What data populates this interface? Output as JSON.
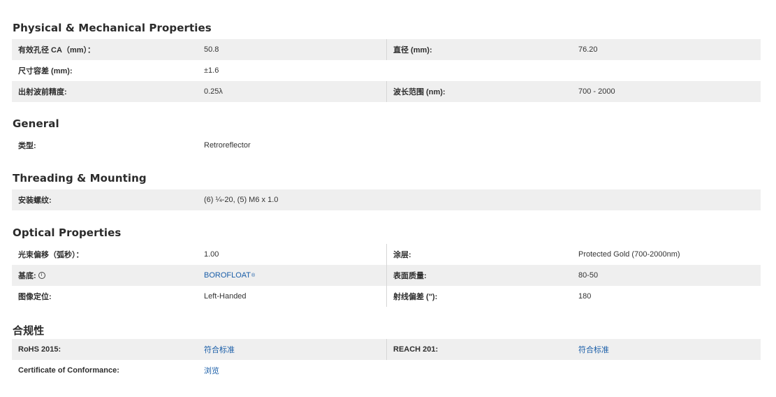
{
  "sections": {
    "physical": {
      "title": "Physical & Mechanical Properties",
      "rows": [
        {
          "l1": "有效孔径 CA（mm）：",
          "v1": "50.8",
          "l2": "直径 (mm):",
          "v2": "76.20"
        },
        {
          "l1": "尺寸容差 (mm):",
          "v1": "±1.6",
          "l2": "",
          "v2": ""
        },
        {
          "l1": "出射波前精度:",
          "v1": "0.25λ",
          "l2": "波长范围 (nm):",
          "v2": "700 - 2000"
        }
      ]
    },
    "general": {
      "title": "General",
      "rows": [
        {
          "l1": "类型:",
          "v1": "Retroreflector"
        }
      ]
    },
    "threading": {
      "title": "Threading & Mounting",
      "rows": [
        {
          "l1": "安装螺纹:",
          "v1": "(6) ¼-20, (5) M6 x 1.0"
        }
      ]
    },
    "optical": {
      "title": "Optical Properties",
      "rows": [
        {
          "l1": "光束偏移（弧秒）：",
          "v1": "1.00",
          "l2": "涂层:",
          "v2": "Protected Gold (700-2000nm)"
        },
        {
          "l1": "基底:",
          "v1": "BOROFLOAT",
          "v1_sup": "®",
          "l2": "表面质量:",
          "v2": "80-50"
        },
        {
          "l1": "图像定位:",
          "v1": "Left-Handed",
          "l2": "射线偏差 (\"):",
          "v2": "180"
        }
      ]
    },
    "compliance": {
      "title": "合规性",
      "rows": [
        {
          "l1": "RoHS 2015:",
          "v1": "符合标准",
          "l2": "REACH 201:",
          "v2": "符合标准"
        },
        {
          "l1": "Certificate of Conformance:",
          "v1": "浏览"
        }
      ]
    }
  },
  "icons": {
    "substrate_info": "info-circle-icon"
  },
  "colors": {
    "row_shade": "#efefef",
    "link": "#1a5ea8",
    "heading": "#2b2b2b"
  }
}
